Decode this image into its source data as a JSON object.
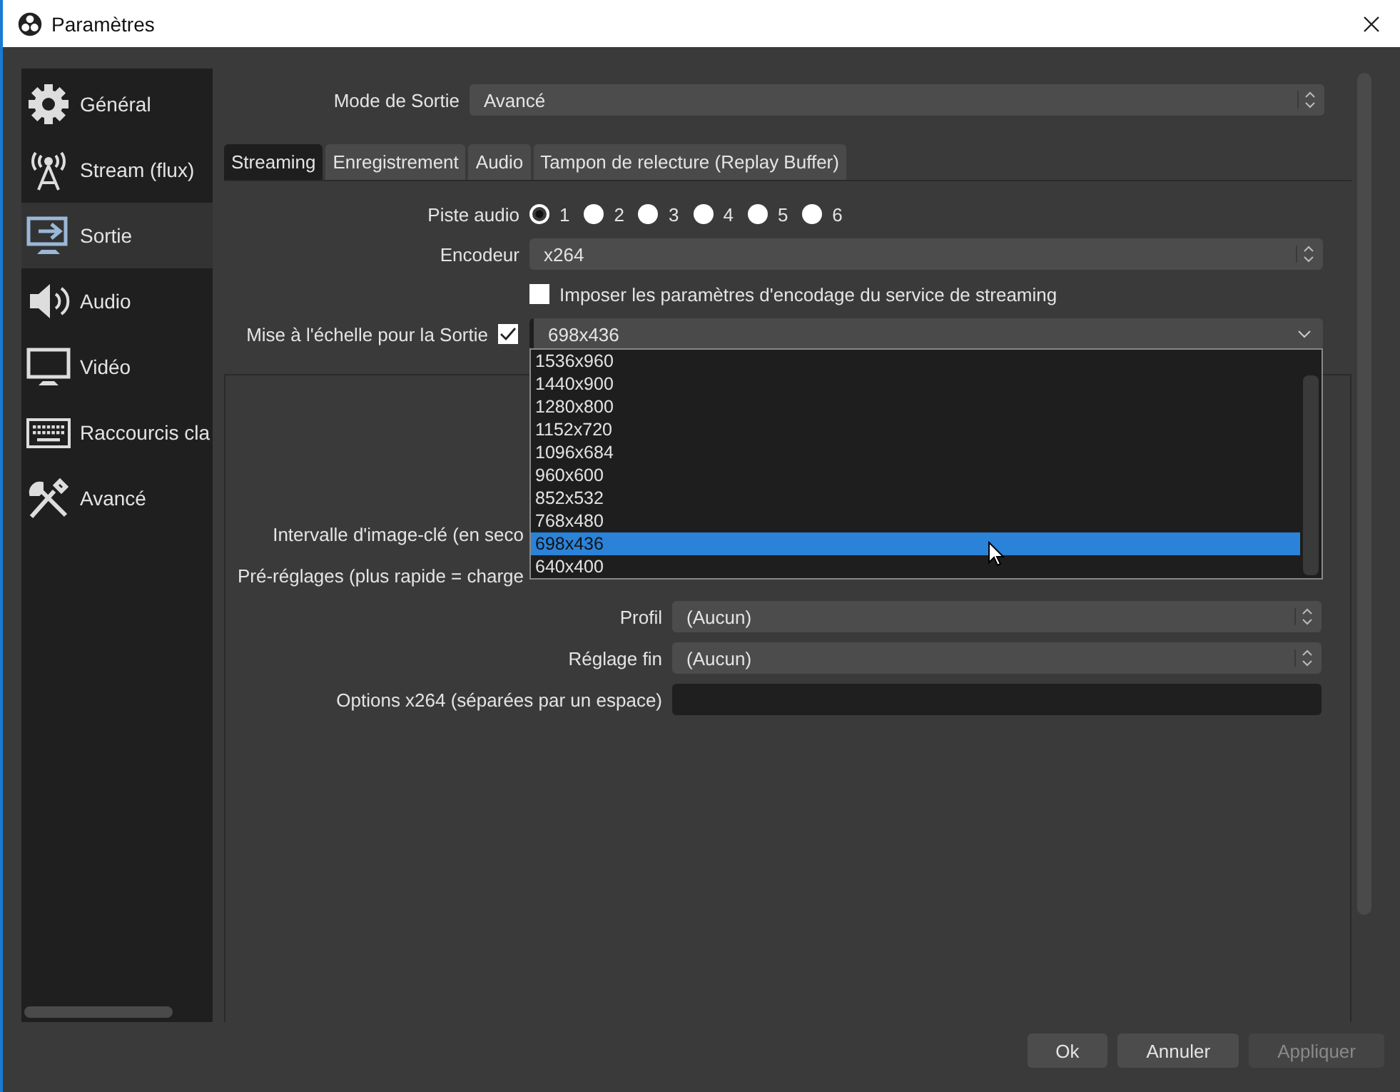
{
  "window": {
    "title": "Paramètres"
  },
  "sidebar": {
    "items": [
      {
        "kind": "gear",
        "label": "Général",
        "selected": false
      },
      {
        "kind": "stream",
        "label": "Stream (flux)",
        "selected": false
      },
      {
        "kind": "output",
        "label": "Sortie",
        "selected": true
      },
      {
        "kind": "audio",
        "label": "Audio",
        "selected": false
      },
      {
        "kind": "video",
        "label": "Vidéo",
        "selected": false
      },
      {
        "kind": "hotkeys",
        "label": "Raccourcis cla",
        "selected": false
      },
      {
        "kind": "advanced",
        "label": "Avancé",
        "selected": false
      }
    ]
  },
  "output_mode": {
    "label": "Mode de Sortie",
    "value": "Avancé"
  },
  "tabs": [
    {
      "label": "Streaming",
      "selected": true
    },
    {
      "label": "Enregistrement",
      "selected": false
    },
    {
      "label": "Audio",
      "selected": false
    },
    {
      "label": "Tampon de relecture (Replay Buffer)",
      "selected": false
    }
  ],
  "audio_track": {
    "label": "Piste audio",
    "options": [
      {
        "label": "1",
        "selected": true
      },
      {
        "label": "2",
        "selected": false
      },
      {
        "label": "3",
        "selected": false
      },
      {
        "label": "4",
        "selected": false
      },
      {
        "label": "5",
        "selected": false
      },
      {
        "label": "6",
        "selected": false
      }
    ]
  },
  "encoder": {
    "label": "Encodeur",
    "value": "x264"
  },
  "enforce": {
    "label": "Imposer les paramètres d'encodage du service de streaming",
    "checked": false
  },
  "rescale": {
    "label": "Mise à l'échelle pour la Sortie",
    "checked": true,
    "value": "698x436",
    "options": [
      {
        "label": "1536x960",
        "selected": false
      },
      {
        "label": "1440x900",
        "selected": false
      },
      {
        "label": "1280x800",
        "selected": false
      },
      {
        "label": "1152x720",
        "selected": false
      },
      {
        "label": "1096x684",
        "selected": false
      },
      {
        "label": "960x600",
        "selected": false
      },
      {
        "label": "852x532",
        "selected": false
      },
      {
        "label": "768x480",
        "selected": false
      },
      {
        "label": "698x436",
        "selected": true
      },
      {
        "label": "640x400",
        "selected": false
      }
    ]
  },
  "encoder_settings": [
    {
      "kind": "covered",
      "label": "Intervalle d'image-clé (en seco"
    },
    {
      "kind": "covered",
      "label": "Pré-réglages (plus rapide = charge"
    },
    {
      "kind": "select",
      "label": "Profil",
      "value": "(Aucun)"
    },
    {
      "kind": "select",
      "label": "Réglage fin",
      "value": "(Aucun)"
    },
    {
      "kind": "input",
      "label": "Options x264 (séparées par un espace)"
    }
  ],
  "buttons": [
    {
      "label": "Ok",
      "disabled": false
    },
    {
      "label": "Annuler",
      "disabled": false
    },
    {
      "label": "Appliquer",
      "disabled": true
    }
  ]
}
